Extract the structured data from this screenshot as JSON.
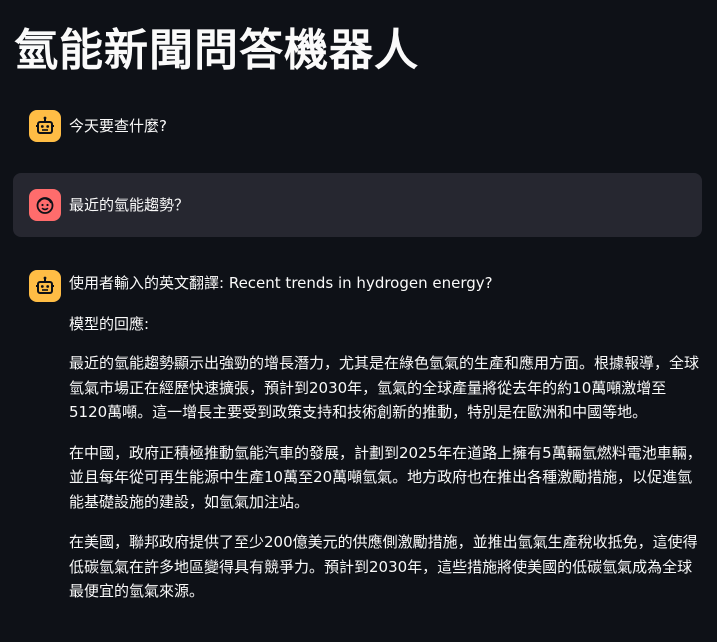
{
  "app": {
    "title": "氫能新聞問答機器人"
  },
  "messages": [
    {
      "role": "assistant",
      "avatar_icon": "robot-face-icon",
      "text": "今天要查什麼?"
    },
    {
      "role": "user",
      "avatar_icon": "smiling-face-icon",
      "text": "最近的氫能趨勢？"
    },
    {
      "role": "assistant",
      "avatar_icon": "robot-face-icon",
      "translation_line": "使用者輸入的英文翻譯: Recent trends in hydrogen energy?",
      "response_label": "模型的回應:",
      "paragraphs": [
        "最近的氫能趨勢顯示出強勁的增長潛力，尤其是在綠色氫氣的生產和應用方面。根據報導，全球氫氣市場正在經歷快速擴張，預計到2030年，氫氣的全球產量將從去年的約10萬噸激增至5120萬噸。這一增長主要受到政策支持和技術創新的推動，特別是在歐洲和中國等地。",
        "在中國，政府正積極推動氫能汽車的發展，計劃到2025年在道路上擁有5萬輛氫燃料電池車輛，並且每年從可再生能源中生產10萬至20萬噸氫氣。地方政府也在推出各種激勵措施，以促進氫能基礎設施的建設，如氫氣加注站。",
        "在美國，聯邦政府提供了至少200億美元的供應側激勵措施，並推出氫氣生產稅收抵免，這使得低碳氫氣在許多地區變得具有競爭力。預計到2030年，這些措施將使美國的低碳氫氣成為全球最便宜的氫氣來源。"
      ]
    }
  ],
  "colors": {
    "background": "#0e1117",
    "user_bubble": "#262730",
    "bot_avatar": "#ffbd45",
    "user_avatar": "#ff6c6c",
    "text": "#fafafa"
  }
}
